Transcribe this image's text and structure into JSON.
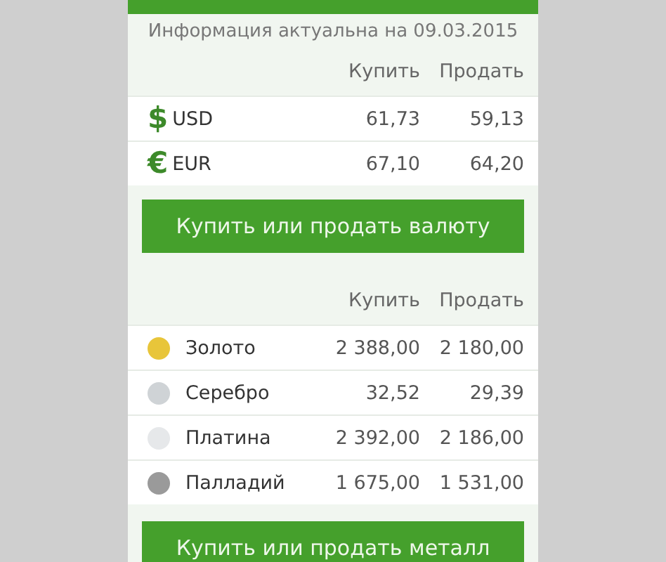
{
  "info": "Информация актуальна на 09.03.2015",
  "currency": {
    "columns": [
      "Купить",
      "Продать"
    ],
    "rows": [
      {
        "symbol": "$",
        "code": "USD",
        "buy": "61,73",
        "sell": "59,13"
      },
      {
        "symbol": "€",
        "code": "EUR",
        "buy": "67,10",
        "sell": "64,20"
      }
    ],
    "button": "Купить или продать валюту"
  },
  "metals": {
    "columns": [
      "Купить",
      "Продать"
    ],
    "rows": [
      {
        "name": "Золото",
        "color": "#e8c53a",
        "buy": "2 388,00",
        "sell": "2 180,00"
      },
      {
        "name": "Серебро",
        "color": "#cfd3d6",
        "buy": "32,52",
        "sell": "29,39"
      },
      {
        "name": "Платина",
        "color": "#e6e8ea",
        "buy": "2 392,00",
        "sell": "2 186,00"
      },
      {
        "name": "Палладий",
        "color": "#9a9a9a",
        "buy": "1 675,00",
        "sell": "1 531,00"
      }
    ],
    "button": "Купить или продать металл"
  }
}
